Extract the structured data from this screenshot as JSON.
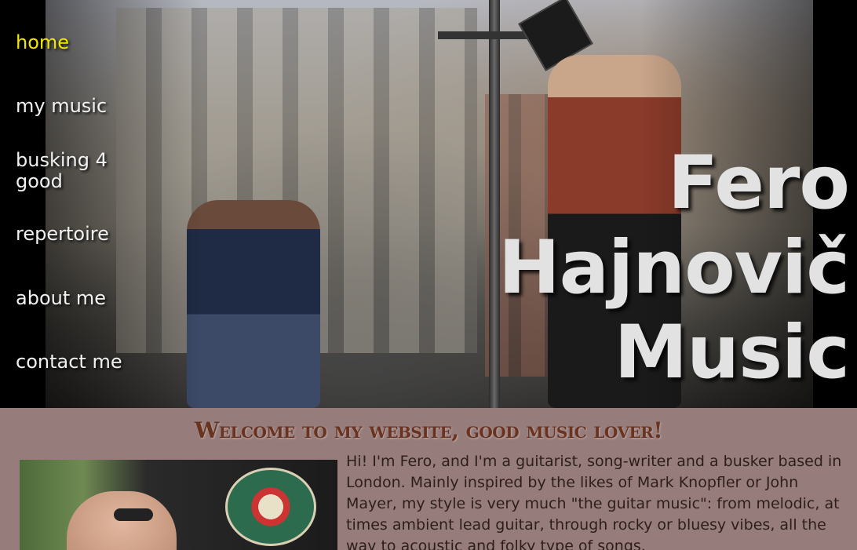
{
  "nav": {
    "items": [
      {
        "label": "home",
        "active": true
      },
      {
        "label": "my music",
        "active": false
      },
      {
        "label": "busking 4 good",
        "active": false
      },
      {
        "label": "repertoire",
        "active": false
      },
      {
        "label": "about me",
        "active": false
      },
      {
        "label": "contact me",
        "active": false
      }
    ]
  },
  "hero": {
    "title_lines": [
      "Fero",
      "Hajnovič",
      "Music"
    ]
  },
  "main": {
    "welcome": "Welcome to my website, good music lover!",
    "intro": "Hi!  I'm  Fero, and  I'm a guitarist, song-writer and a busker based in London.  Mainly inspired by the likes of  Mark  Knopfler or John  Mayer, my style is very much \"the guitar music\": from melodic, at times ambient lead guitar, through rocky or bluesy vibes, all the way to acoustic and folky type of songs."
  },
  "colors": {
    "nav_active": "#f3e600",
    "nav_text": "#f1f1f1",
    "content_bg": "#967d7c",
    "welcome_text": "#6a3320"
  }
}
